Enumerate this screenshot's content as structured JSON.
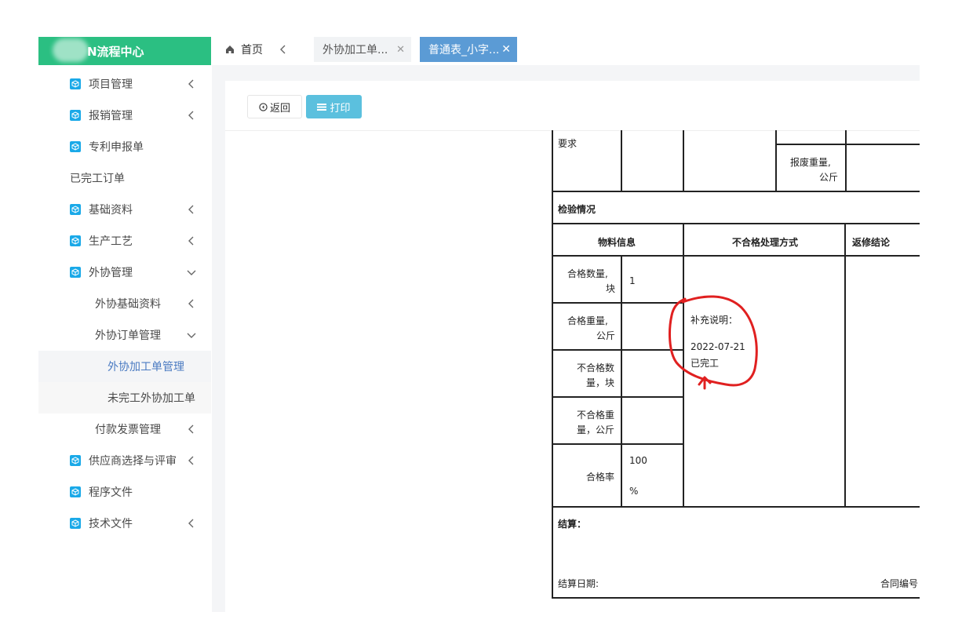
{
  "sidebar": {
    "brand": "N流程中心",
    "items": [
      {
        "label": "项目管理"
      },
      {
        "label": "报销管理"
      },
      {
        "label": "专利申报单"
      },
      {
        "label": "已完工订单"
      },
      {
        "label": "基础资料"
      },
      {
        "label": "生产工艺"
      },
      {
        "label": "外协管理"
      },
      {
        "label": "外协基础资料"
      },
      {
        "label": "外协订单管理"
      },
      {
        "label": "外协加工单管理"
      },
      {
        "label": "未完工外协加工单"
      },
      {
        "label": "付款发票管理"
      },
      {
        "label": "供应商选择与评审"
      },
      {
        "label": "程序文件"
      },
      {
        "label": "技术文件"
      }
    ]
  },
  "tabs": {
    "home": "首页",
    "tab1": "外协加工单...",
    "tab2": "普通表_小字..."
  },
  "toolbar": {
    "back": "返回",
    "print": "打印"
  },
  "doc": {
    "requirement_label": "要求",
    "scrap_weight_label1": "报废重量,",
    "scrap_weight_label2": "公斤",
    "inspection_title": "检验情况",
    "col_material": "物料信息",
    "col_defect_handling": "不合格处理方式",
    "col_rework": "返修结论",
    "qualified_qty_1": "合格数量,",
    "qualified_qty_2": "块",
    "qualified_qty_value": "1",
    "qualified_weight_1": "合格重量,",
    "qualified_weight_2": "公斤",
    "unqualified_qty_1": "不合格数",
    "unqualified_qty_2": "量，块",
    "unqualified_weight_1": "不合格重",
    "unqualified_weight_2": "量，公斤",
    "pass_rate_label": "合格率",
    "pass_rate_value": "100",
    "pass_rate_unit": "%",
    "supplement_label": "补充说明：",
    "supplement_date": "2022-07-21",
    "supplement_status": "已完工",
    "settlement_label": "结算：",
    "settlement_date_label": "结算日期:",
    "contract_no_label": "合同编号"
  },
  "colors": {
    "brand": "#2bbf82",
    "accent_tab": "#5b9bd5",
    "print_button": "#5bc0de",
    "menu_icon": "#1aa9e8",
    "annotation": "#e02020"
  }
}
